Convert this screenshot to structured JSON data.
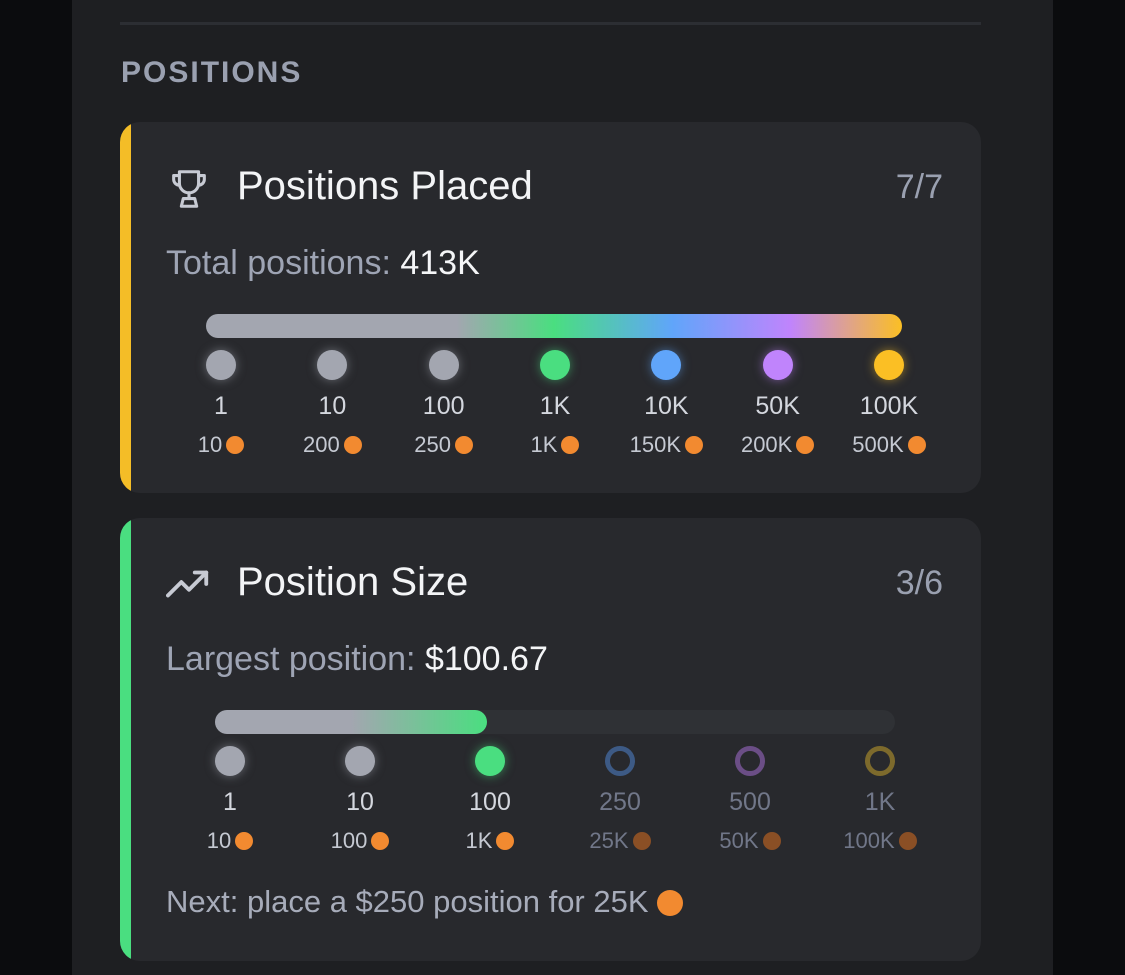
{
  "section": {
    "title": "POSITIONS"
  },
  "cards": [
    {
      "icon": "trophy-icon",
      "title": "Positions Placed",
      "count": "7/7",
      "stat_label": "Total positions:",
      "stat_value": "413K",
      "accent": "#f4bd27",
      "progress": 1.0,
      "tiers": [
        {
          "label": "1",
          "reward": "10",
          "color": "#a3a6b0",
          "achieved": true
        },
        {
          "label": "10",
          "reward": "200",
          "color": "#a3a6b0",
          "achieved": true
        },
        {
          "label": "100",
          "reward": "250",
          "color": "#a3a6b0",
          "achieved": true
        },
        {
          "label": "1K",
          "reward": "1K",
          "color": "#4ade80",
          "achieved": true
        },
        {
          "label": "10K",
          "reward": "150K",
          "color": "#60a5fa",
          "achieved": true
        },
        {
          "label": "50K",
          "reward": "200K",
          "color": "#c084fc",
          "achieved": true
        },
        {
          "label": "100K",
          "reward": "500K",
          "color": "#fbbf24",
          "achieved": true
        }
      ]
    },
    {
      "icon": "trending-up-icon",
      "title": "Position Size",
      "count": "3/6",
      "stat_label": "Largest position:",
      "stat_value": "$100.67",
      "accent": "#4ade80",
      "progress": 0.4,
      "tiers": [
        {
          "label": "1",
          "reward": "10",
          "color": "#a3a6b0",
          "achieved": true
        },
        {
          "label": "10",
          "reward": "100",
          "color": "#a3a6b0",
          "achieved": true
        },
        {
          "label": "100",
          "reward": "1K",
          "color": "#4ade80",
          "achieved": true
        },
        {
          "label": "250",
          "reward": "25K",
          "color": "#3d5a85",
          "achieved": false
        },
        {
          "label": "500",
          "reward": "50K",
          "color": "#6b4e86",
          "achieved": false
        },
        {
          "label": "1K",
          "reward": "100K",
          "color": "#7d6a2c",
          "achieved": false
        }
      ],
      "next": "Next: place a $250 position for 25K"
    }
  ],
  "colors": {
    "coin": "#f28a30",
    "coin_locked": "#8a4f25"
  }
}
